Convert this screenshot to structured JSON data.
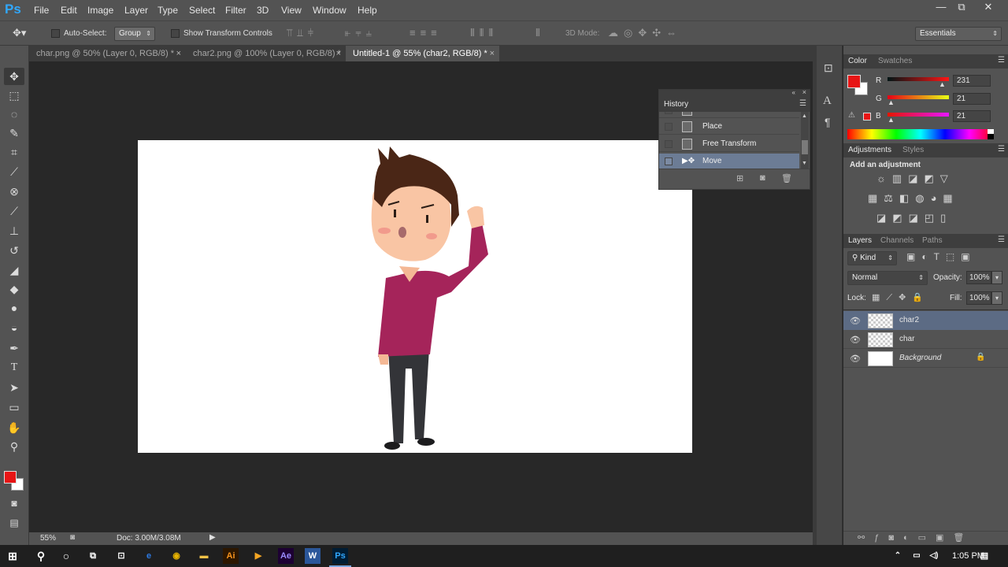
{
  "app": {
    "logo": "Ps"
  },
  "menu": [
    "File",
    "Edit",
    "Image",
    "Layer",
    "Type",
    "Select",
    "Filter",
    "3D",
    "View",
    "Window",
    "Help"
  ],
  "window_controls": {
    "minimize": "—",
    "restore": "⧉",
    "close": "✕"
  },
  "options": {
    "auto_select_label": "Auto-Select:",
    "auto_select_value": "Group",
    "transform_label": "Show Transform Controls",
    "mode3d_label": "3D Mode:",
    "workspace": "Essentials"
  },
  "doc_tabs": [
    {
      "label": "char.png @ 50% (Layer 0, RGB/8) *",
      "close": "×"
    },
    {
      "label": "char2.png @ 100% (Layer 0, RGB/8) *",
      "close": "×"
    },
    {
      "label": "Untitled-1 @ 55% (char2, RGB/8) *",
      "close": "×"
    }
  ],
  "status": {
    "zoom": "55%",
    "doc": "Doc: 3.00M/3.08M"
  },
  "history": {
    "title": "History",
    "items": [
      {
        "label": "Place"
      },
      {
        "label": "Place"
      },
      {
        "label": "Free Transform"
      },
      {
        "label": "Move"
      }
    ]
  },
  "color_panel": {
    "tabs": [
      "Color",
      "Swatches"
    ],
    "channels": [
      {
        "label": "R",
        "value": "231"
      },
      {
        "label": "G",
        "value": "21"
      },
      {
        "label": "B",
        "value": "21"
      }
    ],
    "foreground": "#e71515"
  },
  "adjustments": {
    "tabs": [
      "Adjustments",
      "Styles"
    ],
    "heading": "Add an adjustment"
  },
  "layers": {
    "tabs": [
      "Layers",
      "Channels",
      "Paths"
    ],
    "filter_kind": "Kind",
    "blend_mode": "Normal",
    "opacity_label": "Opacity:",
    "opacity": "100%",
    "lock_label": "Lock:",
    "fill_label": "Fill:",
    "fill": "100%",
    "items": [
      {
        "name": "char2"
      },
      {
        "name": "char"
      },
      {
        "name": "Background"
      }
    ]
  },
  "taskbar": {
    "time": "1:05 PM"
  }
}
